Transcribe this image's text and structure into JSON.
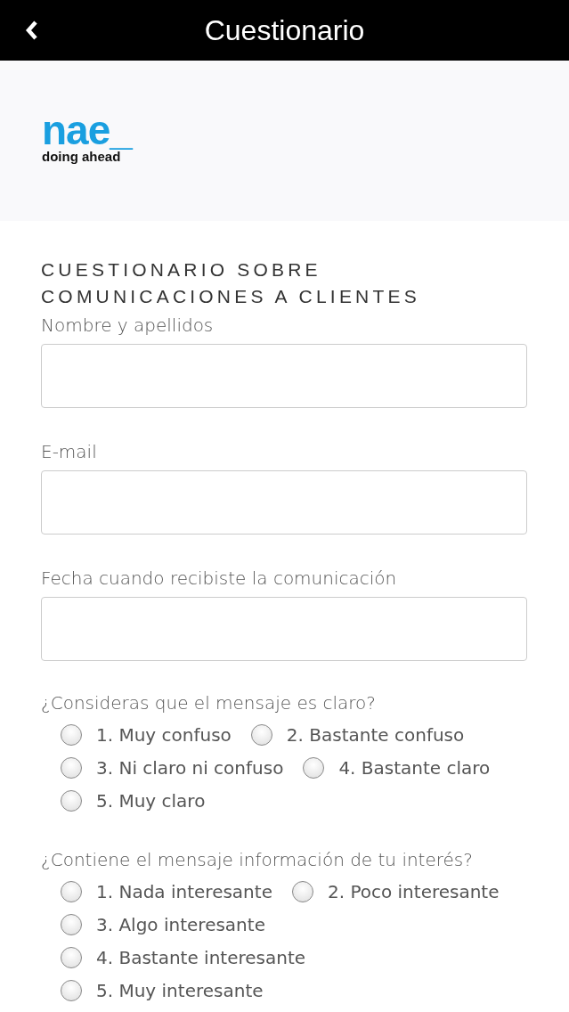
{
  "header": {
    "title": "Cuestionario"
  },
  "logo": {
    "wordmark": "nae_",
    "tagline": "doing ahead"
  },
  "form": {
    "title": "CUESTIONARIO SOBRE COMUNICACIONES A CLIENTES",
    "fields": [
      {
        "label": "Nombre y apellidos"
      },
      {
        "label": "E-mail"
      },
      {
        "label": "Fecha cuando recibiste la comunicación"
      }
    ],
    "questions": [
      {
        "text": "¿Consideras que el mensaje es claro?",
        "options": [
          {
            "label": "1. Muy confuso",
            "selected": false
          },
          {
            "label": "2. Bastante confuso",
            "selected": false
          },
          {
            "label": "3. Ni claro ni confuso",
            "selected": false
          },
          {
            "label": "4. Bastante claro",
            "selected": false
          },
          {
            "label": "5. Muy claro",
            "selected": false
          }
        ]
      },
      {
        "text": "¿Contiene el mensaje información de tu interés?",
        "options": [
          {
            "label": "1. Nada interesante",
            "selected": false
          },
          {
            "label": "2. Poco interesante",
            "selected": false
          },
          {
            "label": "3. Algo interesante",
            "selected": false
          },
          {
            "label": "4. Bastante interesante",
            "selected": false
          },
          {
            "label": "5. Muy interesante",
            "selected": false
          }
        ]
      }
    ]
  }
}
